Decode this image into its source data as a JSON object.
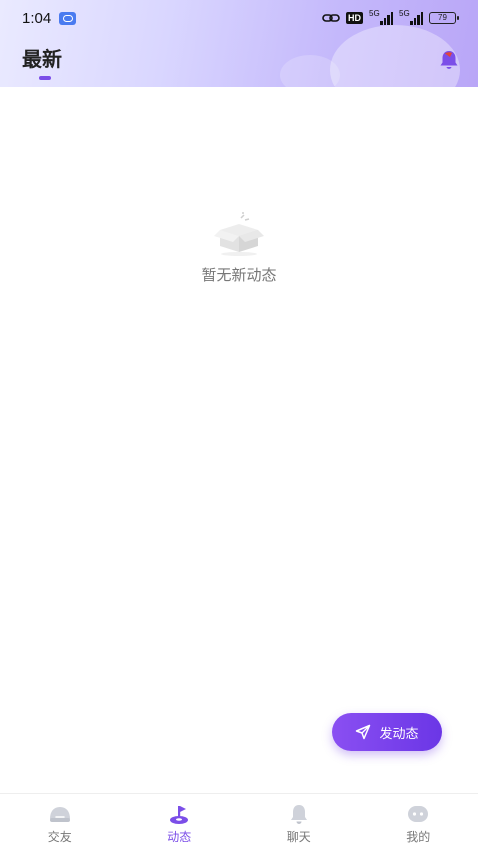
{
  "status_bar": {
    "time": "1:04",
    "hd_badge": "HD",
    "signal_1_label": "5G",
    "signal_2_label": "5G",
    "battery": "79"
  },
  "header": {
    "title": "最新",
    "bell_icon": "bell-icon"
  },
  "empty_state": {
    "icon": "empty-box-icon",
    "message": "暂无新动态"
  },
  "fab": {
    "label": "发动态",
    "icon": "send-icon"
  },
  "tabbar": {
    "active_color": "#7b4ee8",
    "inactive_color": "#777777",
    "items": [
      {
        "label": "交友",
        "icon": "friends-icon"
      },
      {
        "label": "动态",
        "icon": "moments-icon"
      },
      {
        "label": "聊天",
        "icon": "chat-bell-icon"
      },
      {
        "label": "我的",
        "icon": "profile-icon"
      }
    ]
  },
  "colors": {
    "accent": "#7b4ee8",
    "fab_gradient_start": "#8a4ff2",
    "fab_gradient_end": "#6b36e6"
  }
}
